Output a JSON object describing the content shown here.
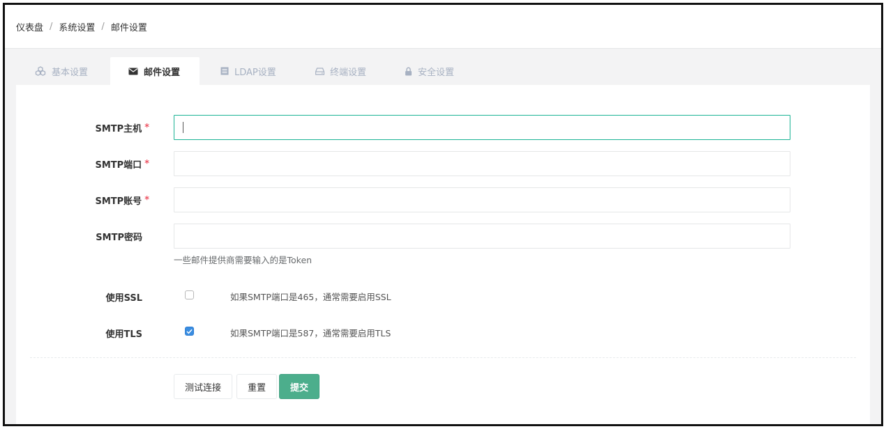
{
  "breadcrumb": {
    "items": [
      "仪表盘",
      "系统设置",
      "邮件设置"
    ],
    "separator": "/"
  },
  "tabs": [
    {
      "label": "基本设置",
      "icon": "cubes-icon",
      "active": false
    },
    {
      "label": "邮件设置",
      "icon": "envelope-icon",
      "active": true
    },
    {
      "label": "LDAP设置",
      "icon": "server-icon",
      "active": false
    },
    {
      "label": "终端设置",
      "icon": "hdd-icon",
      "active": false
    },
    {
      "label": "安全设置",
      "icon": "lock-icon",
      "active": false
    }
  ],
  "form": {
    "smtp_host": {
      "label": "SMTP主机",
      "required_mark": "*",
      "value": ""
    },
    "smtp_port": {
      "label": "SMTP端口",
      "required_mark": "*",
      "value": ""
    },
    "smtp_user": {
      "label": "SMTP账号",
      "required_mark": "*",
      "value": ""
    },
    "smtp_password": {
      "label": "SMTP密码",
      "value": "",
      "help": "一些邮件提供商需要输入的是Token"
    },
    "use_ssl": {
      "label": "使用SSL",
      "checked": false,
      "hint": "如果SMTP端口是465，通常需要启用SSL"
    },
    "use_tls": {
      "label": "使用TLS",
      "checked": true,
      "hint": "如果SMTP端口是587，通常需要启用TLS"
    }
  },
  "buttons": {
    "test": "测试连接",
    "reset": "重置",
    "submit": "提交"
  },
  "colors": {
    "accent": "#1ab394",
    "submit_bg": "#4cae8c",
    "checkbox_checked": "#3a8de0",
    "required": "#ed5565"
  }
}
